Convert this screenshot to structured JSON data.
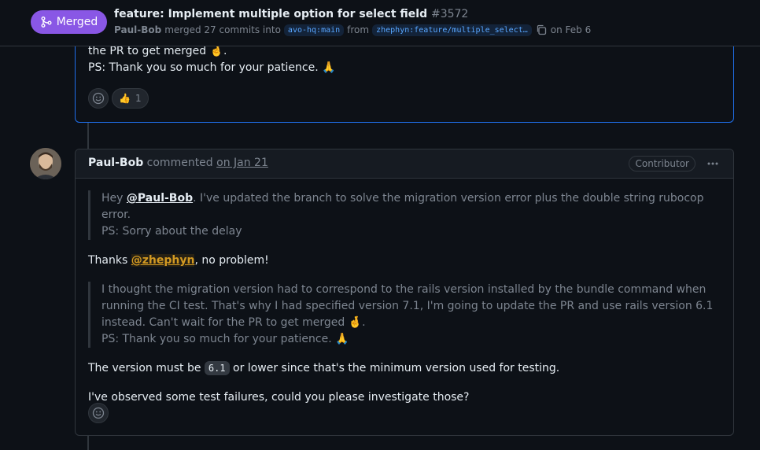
{
  "header": {
    "state_label": "Merged",
    "title": "feature: Implement multiple option for select field",
    "number": "#3572",
    "author": "Paul-Bob",
    "merged_text": "merged 27 commits into",
    "base_branch": "avo-hq:main",
    "from_text": "from",
    "head_branch": "zhephyn:feature/multiple_select…",
    "date_text": "on Feb 6"
  },
  "comment1": {
    "line1": "the PR to get merged 🤞.",
    "line2": "PS: Thank you so much for your patience. 🙏",
    "reaction_emoji": "👍",
    "reaction_count": "1"
  },
  "comment2": {
    "author": "Paul-Bob",
    "action": "commented",
    "date": "on Jan 21",
    "role": "Contributor",
    "quote1_prefix": "Hey ",
    "quote1_mention": "@Paul-Bob",
    "quote1_rest": ". I've updated the branch to solve the migration version error plus the double string rubocop error.",
    "quote1_line2": "PS: Sorry about the delay",
    "thanks_prefix": "Thanks ",
    "thanks_mention": "@zhephyn",
    "thanks_rest": ", no problem!",
    "quote2_text": "I thought the migration version had to correspond to the rails version installed by the bundle command when running the CI test. That's why I had specified version 7.1, I'm going to update the PR and use rails version 6.1 instead. Can't wait for the PR to get merged 🤞.",
    "quote2_line2": "PS: Thank you so much for your patience. 🙏",
    "version_prefix": "The version must be ",
    "version_code": "6.1",
    "version_rest": " or lower since that's the minimum version used for testing.",
    "failures": "I've observed some test failures, could you please investigate those?"
  },
  "colors": {
    "merged": "#8957e5",
    "accent_border": "#1f6feb",
    "mention_self": "#d29922"
  }
}
